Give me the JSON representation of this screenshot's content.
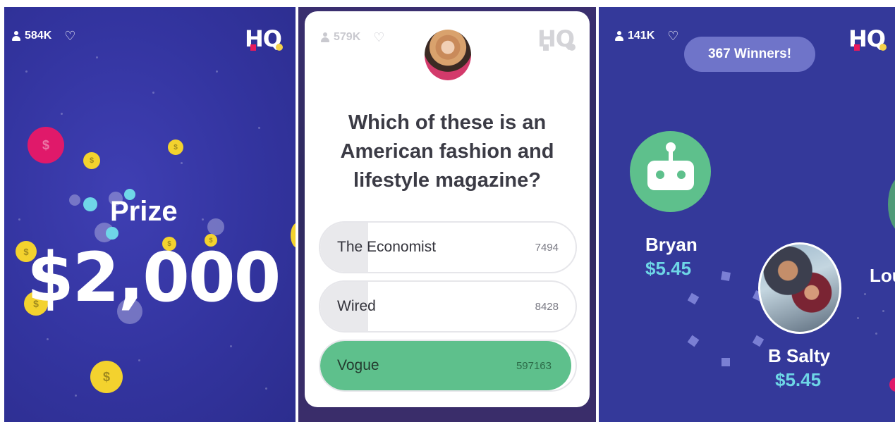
{
  "panels": [
    {
      "viewers": "584K",
      "logo": "HQ",
      "prize_label": "Prize",
      "prize_amount": "$2,000"
    },
    {
      "viewers": "579K",
      "logo": "HQ",
      "question": "Which of these is an American fashion and lifestyle magazine?",
      "answers": [
        {
          "label": "The Economist",
          "count": "7494",
          "correct": false
        },
        {
          "label": "Wired",
          "count": "8428",
          "correct": false
        },
        {
          "label": "Vogue",
          "count": "597163",
          "correct": true
        }
      ]
    },
    {
      "viewers": "141K",
      "logo": "HQ",
      "winners_banner": "367 Winners!",
      "winners": [
        {
          "name": "Bryan",
          "amount": "$5.45"
        },
        {
          "name": "B Salty",
          "amount": "$5.45"
        },
        {
          "name": "Lou",
          "amount": ""
        }
      ]
    }
  ],
  "icons": {
    "viewers": "person-icon",
    "lives": "heart-icon",
    "coin": "dollar-coin-icon",
    "avatar_bot": "robot-icon"
  },
  "colors": {
    "background": "#33349f",
    "correct": "#5ec08c",
    "winnings": "#6ed6e6",
    "pill": "#6f74c9"
  }
}
